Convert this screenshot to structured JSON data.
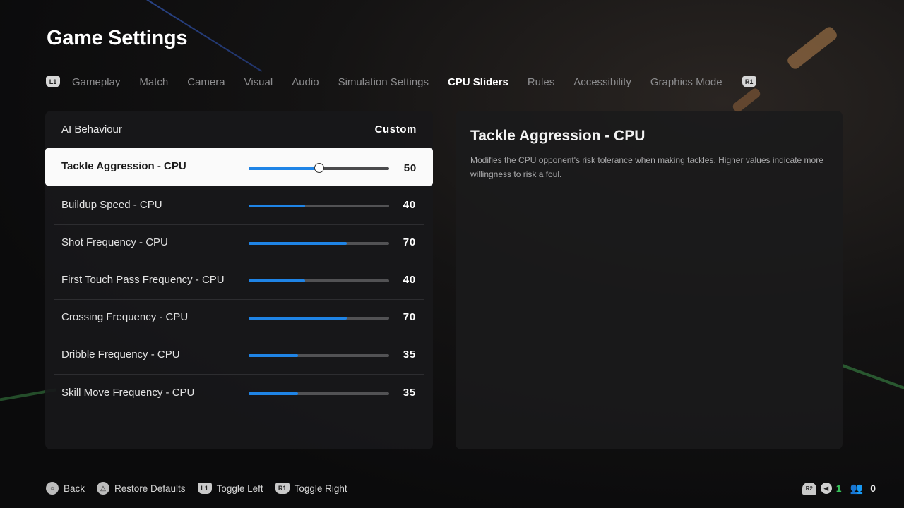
{
  "header": {
    "title": "Game Settings"
  },
  "tabs": {
    "left_button": "L1",
    "right_button": "R1",
    "items": [
      {
        "label": "Gameplay",
        "active": false
      },
      {
        "label": "Match",
        "active": false
      },
      {
        "label": "Camera",
        "active": false
      },
      {
        "label": "Visual",
        "active": false
      },
      {
        "label": "Audio",
        "active": false
      },
      {
        "label": "Simulation Settings",
        "active": false
      },
      {
        "label": "CPU Sliders",
        "active": true
      },
      {
        "label": "Rules",
        "active": false
      },
      {
        "label": "Accessibility",
        "active": false
      },
      {
        "label": "Graphics Mode",
        "active": false
      }
    ]
  },
  "settings": {
    "ai_behaviour": {
      "label": "AI Behaviour",
      "value": "Custom"
    },
    "sliders": [
      {
        "label": "Tackle Aggression - CPU",
        "value": 50,
        "selected": true
      },
      {
        "label": "Buildup Speed - CPU",
        "value": 40,
        "selected": false
      },
      {
        "label": "Shot Frequency - CPU",
        "value": 70,
        "selected": false
      },
      {
        "label": "First Touch Pass Frequency - CPU",
        "value": 40,
        "selected": false
      },
      {
        "label": "Crossing Frequency - CPU",
        "value": 70,
        "selected": false
      },
      {
        "label": "Dribble Frequency - CPU",
        "value": 35,
        "selected": false
      },
      {
        "label": "Skill Move Frequency - CPU",
        "value": 35,
        "selected": false
      }
    ],
    "slider_max": 100,
    "accent_color": "#1f84e6"
  },
  "description": {
    "title": "Tackle Aggression - CPU",
    "body": "Modifies the CPU opponent's risk tolerance when making tackles. Higher values indicate more willingness to risk a foul."
  },
  "footer": {
    "hints": [
      {
        "button": "circle",
        "glyph": "○",
        "label": "Back"
      },
      {
        "button": "triangle",
        "glyph": "△",
        "label": "Restore Defaults"
      },
      {
        "button": "L1",
        "glyph": "L1",
        "label": "Toggle Left"
      },
      {
        "button": "R1",
        "glyph": "R1",
        "label": "Toggle Right"
      }
    ],
    "status": {
      "r2_label": "R2",
      "mic_icon": "◀",
      "online_count": "1",
      "people_icon": "👥",
      "party_count": "0"
    }
  }
}
